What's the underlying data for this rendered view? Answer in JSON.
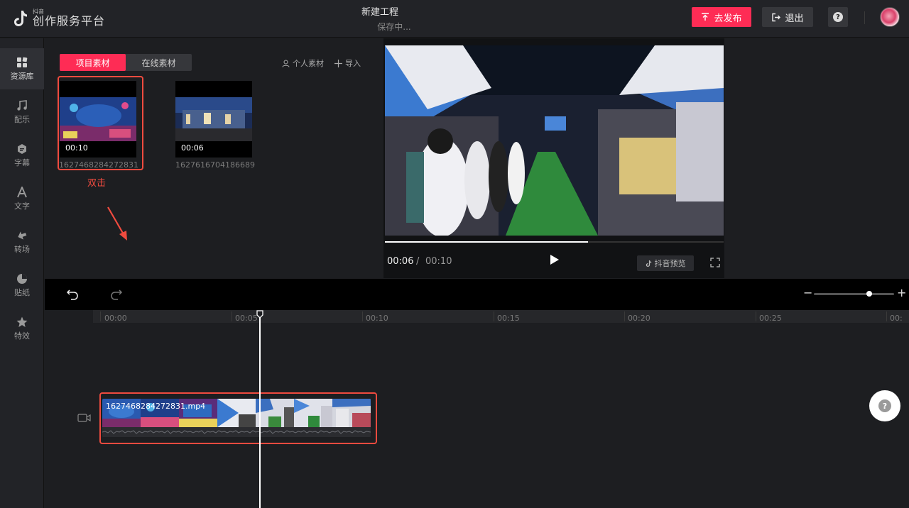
{
  "app": {
    "logo_small": "抖音",
    "logo_big": "创作服务平台",
    "project_title": "新建工程",
    "save_status": "保存中..."
  },
  "header": {
    "publish_label": "去发布",
    "exit_label": "退出",
    "help_label": "?"
  },
  "sidebar": {
    "items": [
      {
        "label": "资源库",
        "icon": "grid-icon",
        "active": true
      },
      {
        "label": "配乐",
        "icon": "music-note-icon"
      },
      {
        "label": "字幕",
        "icon": "subtitle-icon"
      },
      {
        "label": "文字",
        "icon": "text-a-icon"
      },
      {
        "label": "转场",
        "icon": "transition-icon"
      },
      {
        "label": "贴纸",
        "icon": "sticker-icon"
      },
      {
        "label": "特效",
        "icon": "effects-star-icon"
      }
    ]
  },
  "media": {
    "tabs": [
      "项目素材",
      "在线素材"
    ],
    "active_tab": 0,
    "personal_label": "个人素材",
    "import_label": "导入",
    "items": [
      {
        "name": "1627468284272831",
        "duration": "00:10"
      },
      {
        "name": "1627616704186689",
        "duration": "00:06"
      }
    ],
    "hint": "双击"
  },
  "player": {
    "current_time": "00:06",
    "separator": "/",
    "total_time": "00:10",
    "progress": 0.6,
    "preview_label": "抖音预览"
  },
  "timeline": {
    "ticks": [
      "00:00",
      "00:05",
      "00:10",
      "00:15",
      "00:20",
      "00:25",
      "00:"
    ],
    "clip_name": "1627468284272831.mp4",
    "zoom_level": 0.7,
    "fab_label": "?"
  },
  "colors": {
    "accent": "#fe2c55",
    "annotation": "#f04b3f",
    "background": "#1d1e21"
  }
}
